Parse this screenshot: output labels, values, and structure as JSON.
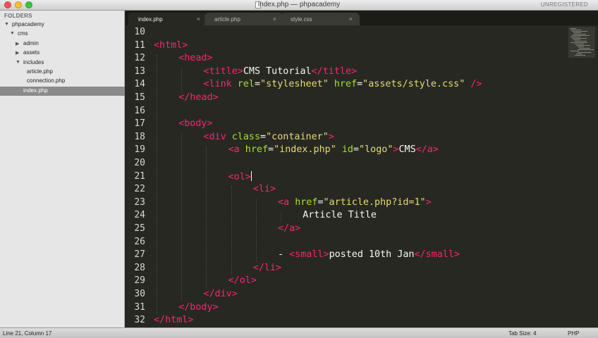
{
  "window": {
    "title": "index.php — phpacademy",
    "unregistered": "UNREGISTERED"
  },
  "sidebar": {
    "heading": "FOLDERS",
    "tree": [
      {
        "label": "phpacademy",
        "depth": 0,
        "arrow": "down"
      },
      {
        "label": "cms",
        "depth": 1,
        "arrow": "down"
      },
      {
        "label": "admin",
        "depth": 2,
        "arrow": "right"
      },
      {
        "label": "assets",
        "depth": 2,
        "arrow": "right"
      },
      {
        "label": "includes",
        "depth": 2,
        "arrow": "down"
      },
      {
        "label": "article.php",
        "depth": 3,
        "arrow": ""
      },
      {
        "label": "connection.php",
        "depth": 3,
        "arrow": ""
      },
      {
        "label": "index.php",
        "depth": 2,
        "arrow": "",
        "selected": true
      }
    ]
  },
  "tabs": [
    {
      "label": "index.php",
      "close": "×",
      "active": true
    },
    {
      "label": "article.php",
      "close": "×",
      "active": false
    },
    {
      "label": "style.css",
      "close": "×",
      "active": false
    }
  ],
  "editor": {
    "line_numbers": [
      "10",
      "11",
      "12",
      "13",
      "14",
      "15",
      "16",
      "17",
      "18",
      "19",
      "20",
      "21",
      "22",
      "23",
      "24",
      "25",
      "26",
      "27",
      "28",
      "29",
      "30",
      "31",
      "32"
    ],
    "lines": [
      [],
      [
        {
          "t": "tag",
          "v": "<html>"
        }
      ],
      [
        {
          "t": "tag",
          "v": "<head>"
        }
      ],
      [
        {
          "t": "tag",
          "v": "<title>"
        },
        {
          "t": "txt",
          "v": "CMS Tutorial"
        },
        {
          "t": "tag",
          "v": "</title>"
        }
      ],
      [
        {
          "t": "tag",
          "v": "<link "
        },
        {
          "t": "attr",
          "v": "rel"
        },
        {
          "t": "txt",
          "v": "="
        },
        {
          "t": "str",
          "v": "\"stylesheet\""
        },
        {
          "t": "txt",
          "v": " "
        },
        {
          "t": "attr",
          "v": "href"
        },
        {
          "t": "txt",
          "v": "="
        },
        {
          "t": "str",
          "v": "\"assets/style.css\""
        },
        {
          "t": "tag",
          "v": " />"
        }
      ],
      [
        {
          "t": "tag",
          "v": "</head>"
        }
      ],
      [],
      [
        {
          "t": "tag",
          "v": "<body>"
        }
      ],
      [
        {
          "t": "tag",
          "v": "<div "
        },
        {
          "t": "attr",
          "v": "class"
        },
        {
          "t": "txt",
          "v": "="
        },
        {
          "t": "str",
          "v": "\"container\""
        },
        {
          "t": "tag",
          "v": ">"
        }
      ],
      [
        {
          "t": "tag",
          "v": "<a "
        },
        {
          "t": "attr",
          "v": "href"
        },
        {
          "t": "txt",
          "v": "="
        },
        {
          "t": "str",
          "v": "\"index.php\""
        },
        {
          "t": "txt",
          "v": " "
        },
        {
          "t": "attr",
          "v": "id"
        },
        {
          "t": "txt",
          "v": "="
        },
        {
          "t": "str",
          "v": "\"logo\""
        },
        {
          "t": "tag",
          "v": ">"
        },
        {
          "t": "txt",
          "v": "CMS"
        },
        {
          "t": "tag",
          "v": "</a>"
        }
      ],
      [],
      [
        {
          "t": "tag",
          "v": "<ol>"
        }
      ],
      [
        {
          "t": "tag",
          "v": "<li>"
        }
      ],
      [
        {
          "t": "tag",
          "v": "<a "
        },
        {
          "t": "attr",
          "v": "href"
        },
        {
          "t": "txt",
          "v": "="
        },
        {
          "t": "str",
          "v": "\"article.php?id=1\""
        },
        {
          "t": "tag",
          "v": ">"
        }
      ],
      [
        {
          "t": "txt",
          "v": "Article Title"
        }
      ],
      [
        {
          "t": "tag",
          "v": "</a>"
        }
      ],
      [],
      [
        {
          "t": "txt",
          "v": "- "
        },
        {
          "t": "tag",
          "v": "<small>"
        },
        {
          "t": "txt",
          "v": "posted 10th Jan"
        },
        {
          "t": "tag",
          "v": "</small>"
        }
      ],
      [
        {
          "t": "tag",
          "v": "</li>"
        }
      ],
      [
        {
          "t": "tag",
          "v": "</ol>"
        }
      ],
      [
        {
          "t": "tag",
          "v": "</div>"
        }
      ],
      [
        {
          "t": "tag",
          "v": "</body>"
        }
      ],
      [
        {
          "t": "tag",
          "v": "</html>"
        }
      ]
    ],
    "indents": [
      0,
      0,
      1,
      2,
      2,
      1,
      0,
      1,
      2,
      3,
      0,
      3,
      4,
      5,
      6,
      5,
      0,
      5,
      4,
      3,
      2,
      1,
      0
    ],
    "caret_line": 21
  },
  "status": {
    "position": "Line 21, Column 17",
    "tab_size": "Tab Size: 4",
    "syntax": "PHP"
  },
  "colors": {
    "background": "#272822",
    "tag": "#f92672",
    "attribute": "#a6e22e",
    "string": "#e6db74",
    "text": "#f8f8f2"
  }
}
